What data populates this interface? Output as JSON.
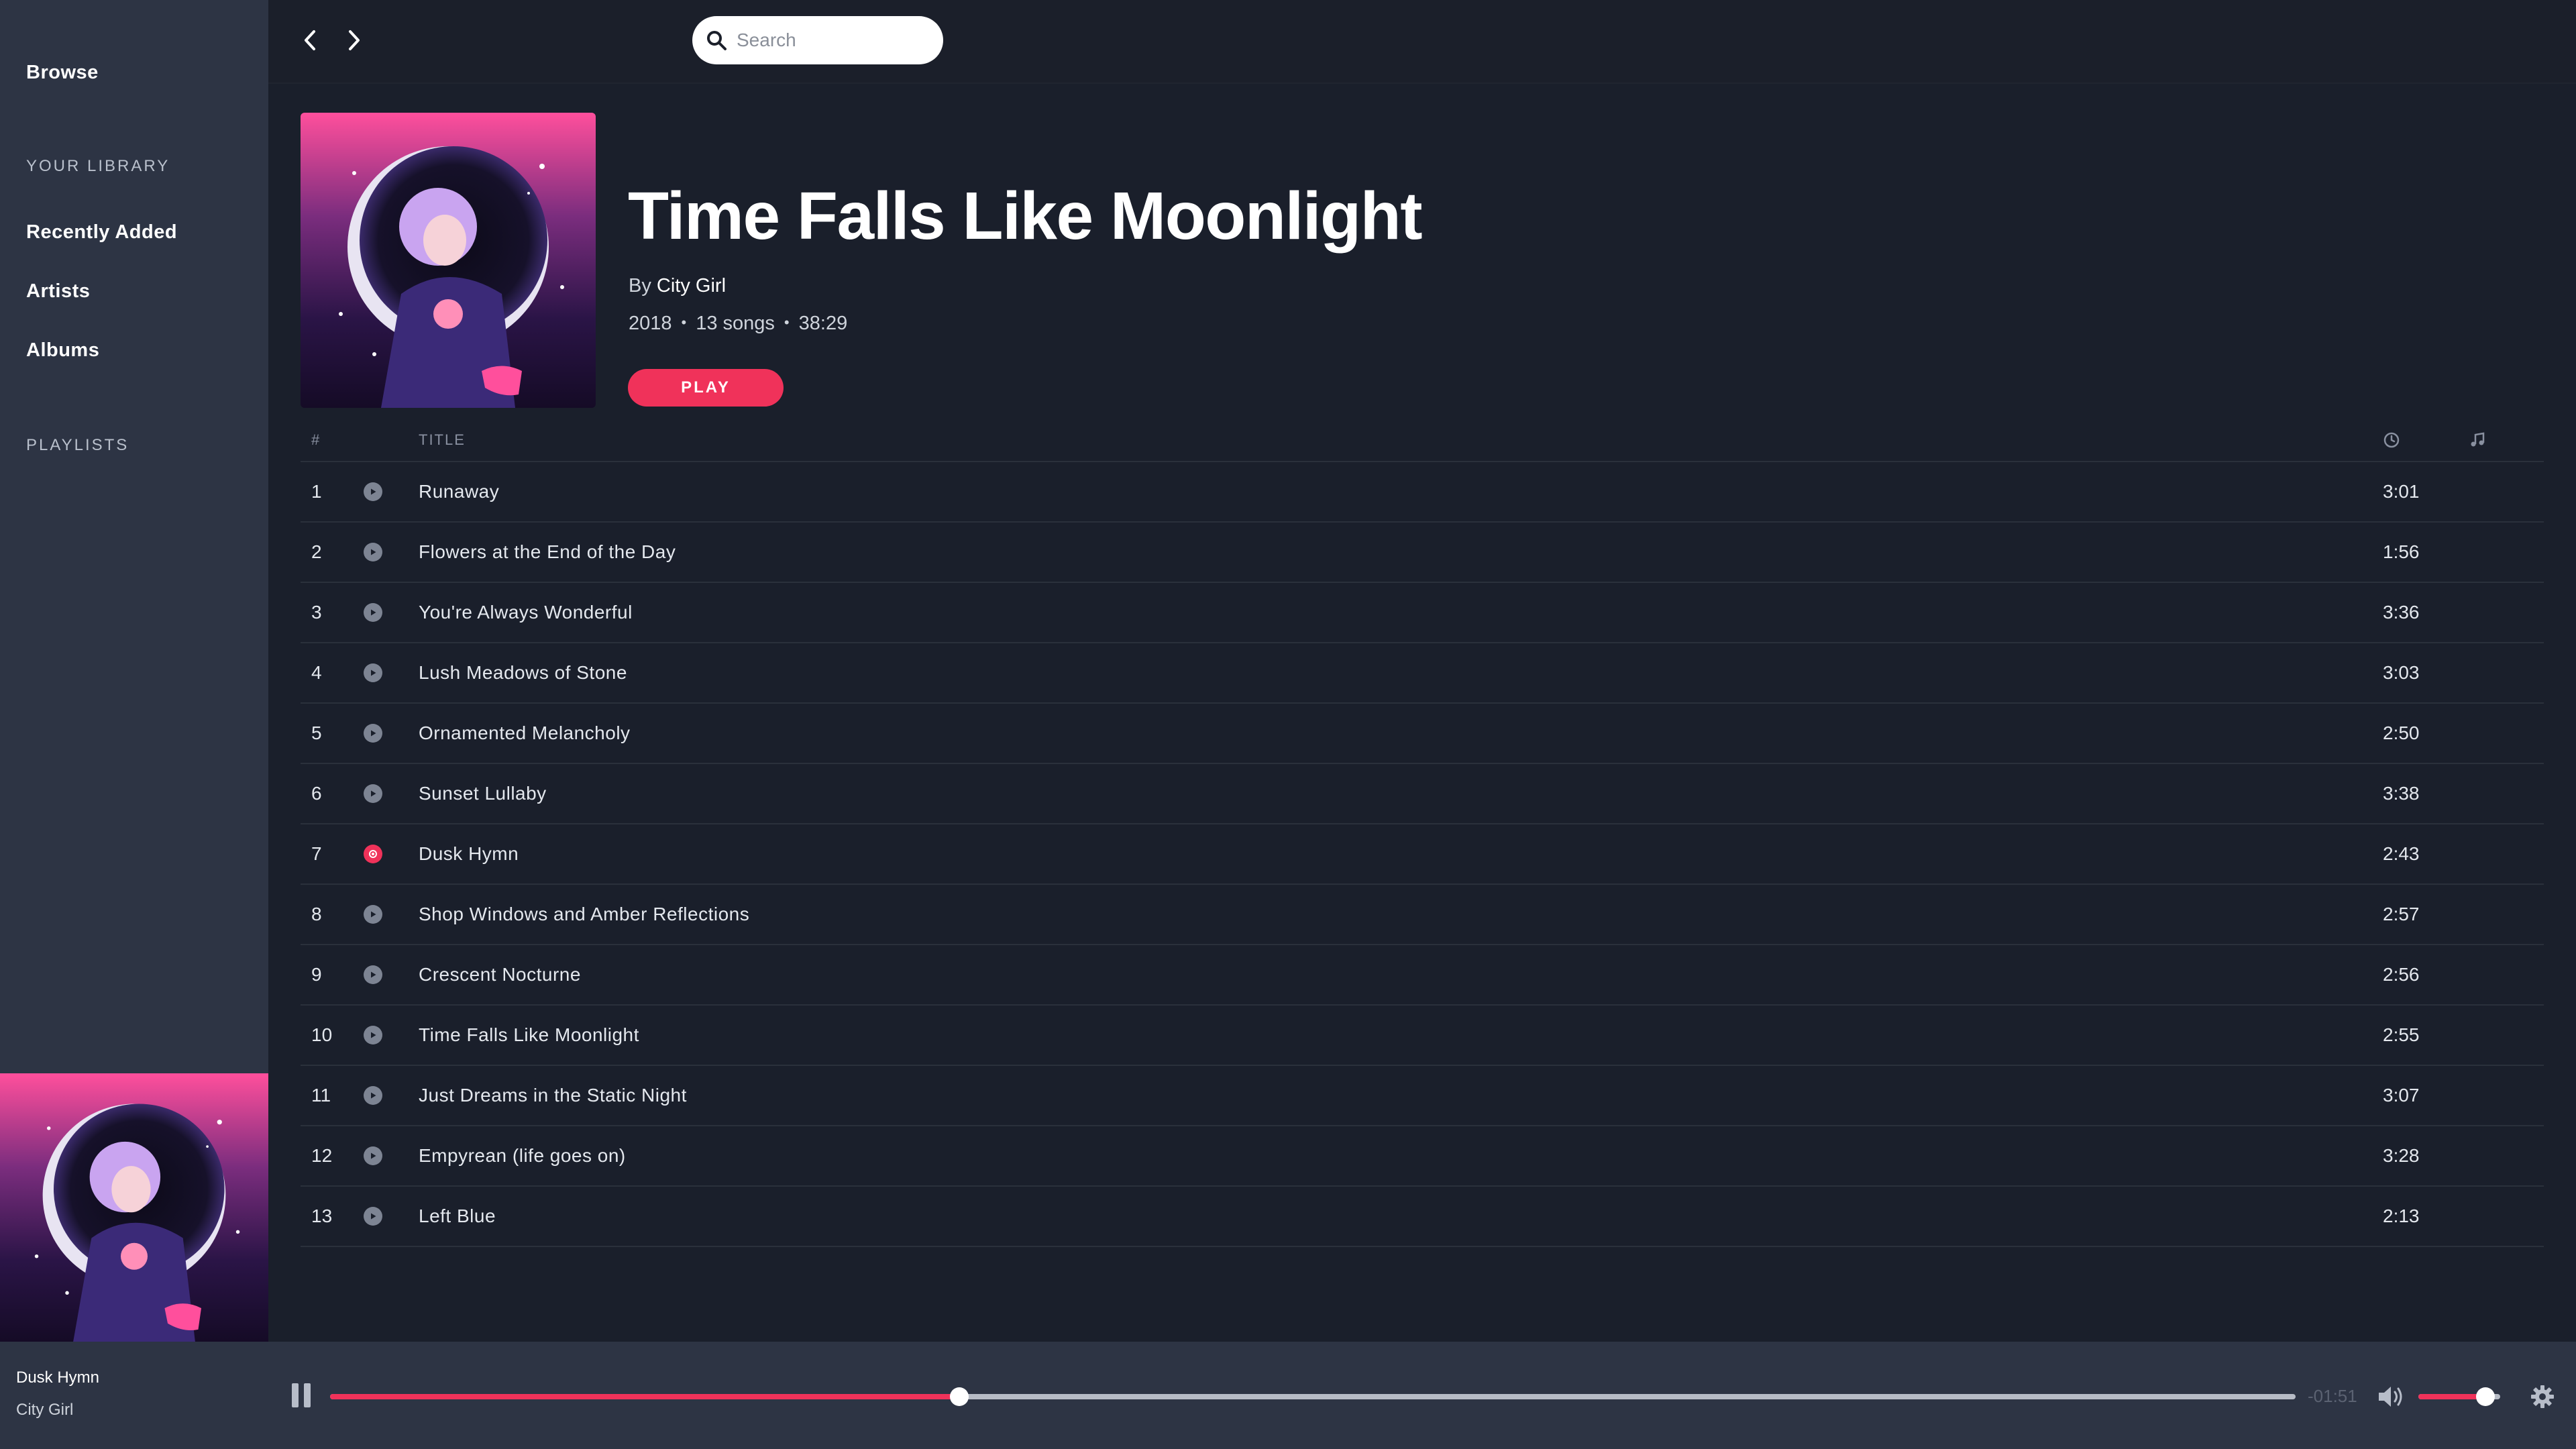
{
  "sidebar": {
    "browse_label": "Browse",
    "library_heading": "YOUR LIBRARY",
    "library_items": [
      {
        "label": "Recently Added"
      },
      {
        "label": "Artists"
      },
      {
        "label": "Albums"
      }
    ],
    "playlists_heading": "PLAYLISTS"
  },
  "search": {
    "placeholder": "Search",
    "icon": "search-icon"
  },
  "album": {
    "title": "Time Falls Like Moonlight",
    "by_prefix": "By",
    "artist": "City Girl",
    "year": "2018",
    "song_count": "13 songs",
    "duration": "38:29",
    "play_label": "PLAY"
  },
  "tracklist": {
    "header_num": "#",
    "header_title": "TITLE",
    "header_duration_icon": "clock-icon",
    "header_music_icon": "music-note-icon",
    "tracks": [
      {
        "num": "1",
        "title": "Runaway",
        "duration": "3:01"
      },
      {
        "num": "2",
        "title": "Flowers at the End of the Day",
        "duration": "1:56"
      },
      {
        "num": "3",
        "title": "You're Always Wonderful",
        "duration": "3:36"
      },
      {
        "num": "4",
        "title": "Lush Meadows of Stone",
        "duration": "3:03"
      },
      {
        "num": "5",
        "title": "Ornamented Melancholy",
        "duration": "2:50"
      },
      {
        "num": "6",
        "title": "Sunset Lullaby",
        "duration": "3:38"
      },
      {
        "num": "7",
        "title": "Dusk Hymn",
        "duration": "2:43",
        "playing": true
      },
      {
        "num": "8",
        "title": "Shop Windows and Amber Reflections",
        "duration": "2:57"
      },
      {
        "num": "9",
        "title": "Crescent Nocturne",
        "duration": "2:56"
      },
      {
        "num": "10",
        "title": "Time Falls Like Moonlight",
        "duration": "2:55"
      },
      {
        "num": "11",
        "title": "Just Dreams in the Static Night",
        "duration": "3:07"
      },
      {
        "num": "12",
        "title": "Empyrean (life goes on)",
        "duration": "3:28"
      },
      {
        "num": "13",
        "title": "Left Blue",
        "duration": "2:13"
      }
    ]
  },
  "player": {
    "now_playing_title": "Dusk Hymn",
    "now_playing_artist": "City Girl",
    "remaining": "-01:51",
    "progress_fraction": 0.32,
    "volume_fraction": 0.82
  },
  "colors": {
    "accent": "#f0325a",
    "background": "#1a1f2b",
    "sidebar": "#2d3444"
  }
}
